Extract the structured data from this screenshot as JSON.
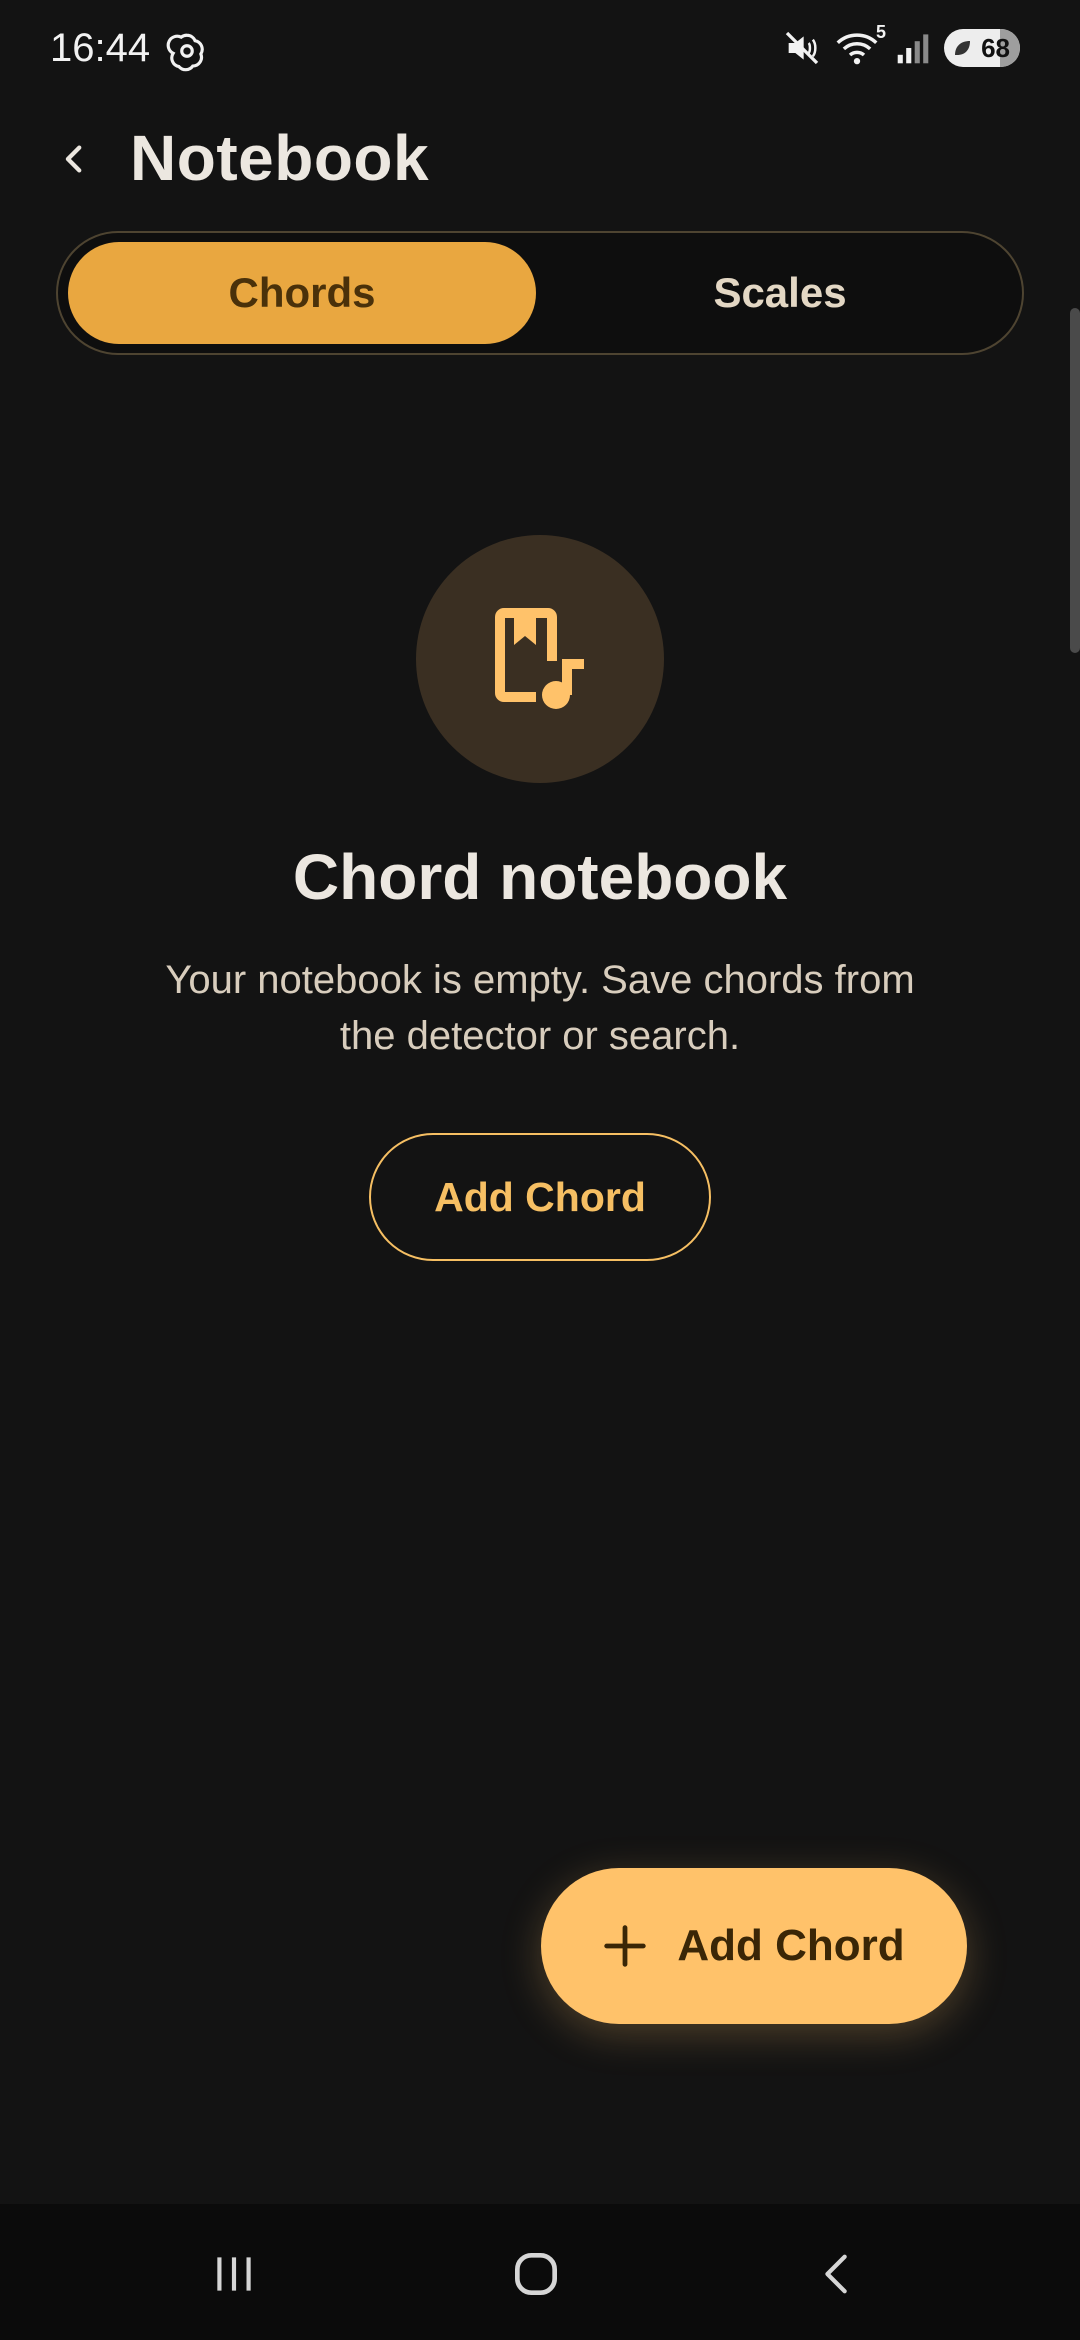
{
  "status_bar": {
    "time": "16:44",
    "app_icon": "openai-logo-icon",
    "icons": [
      "mute-icon",
      "wifi-icon",
      "signal-icon"
    ],
    "wifi_badge": "5",
    "battery_level": "68"
  },
  "header": {
    "back_icon": "chevron-left-icon",
    "title": "Notebook"
  },
  "tabs": [
    {
      "label": "Chords",
      "active": true
    },
    {
      "label": "Scales",
      "active": false
    }
  ],
  "empty_state": {
    "icon": "music-bookmark-icon",
    "title": "Chord notebook",
    "description": "Your notebook is empty. Save chords from the detector or search.",
    "button_label": "Add Chord"
  },
  "fab": {
    "icon": "plus-icon",
    "label": "Add Chord"
  },
  "nav_bar": {
    "items": [
      "recents-icon",
      "home-icon",
      "back-icon"
    ]
  },
  "colors": {
    "background": "#131313",
    "accent": "#E9A740",
    "fab": "#FFC26A",
    "icon_circle": "#3A2F22"
  }
}
